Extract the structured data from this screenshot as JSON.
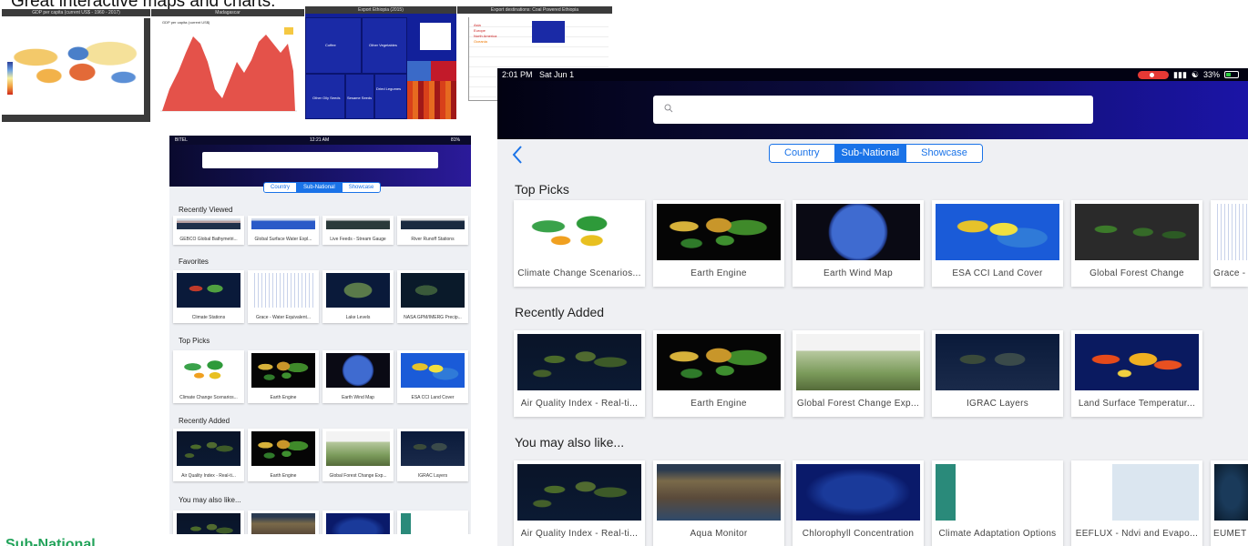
{
  "slide": {
    "title": "Great interactive maps and charts:",
    "footer": "Sub-National",
    "accent_color": "#22a35a"
  },
  "top_thumbnails": [
    {
      "header": "GDP per capita (current US$ - 1960 - 2017)",
      "legend_items": [
        "166,000",
        "50,000",
        "20,000",
        "10,000",
        "5,000",
        "2,000",
        "1,000",
        "500",
        "No data"
      ]
    },
    {
      "header": "Madagascar",
      "y_label": "GDP per capita (current US$)"
    },
    {
      "header": "Export Ethiopia (2015)",
      "cells": [
        "Coffee",
        "Other Vegetables",
        "Other Oily Seeds",
        "Dried Legumes",
        "Sesame Seeds"
      ]
    },
    {
      "header": "Export destinations: Coal Powered Ethiopia",
      "legend": [
        "Asia",
        "Europe",
        "North America",
        "Oceania"
      ]
    }
  ],
  "phone": {
    "status": {
      "carrier": "BITEL",
      "time": "12:21 AM",
      "battery": "81%"
    },
    "segments": [
      "Country",
      "Sub-National",
      "Showcase"
    ],
    "active_segment": "Sub-National",
    "sections": [
      {
        "title": "Recently Viewed",
        "items": [
          "GEBCO Global Bathymetri...",
          "Global Surface Water Expl...",
          "Live Feeds - Stream Gauge",
          "River Runoff Stations"
        ]
      },
      {
        "title": "Favorites",
        "items": [
          "Climate Stations",
          "Grace - Water Equivalent...",
          "Lake Levels",
          "NASA GPM/IMERG Precip..."
        ]
      },
      {
        "title": "Top Picks",
        "items": [
          "Climate Change Scenarios...",
          "Earth Engine",
          "Earth Wind Map",
          "ESA CCI Land Cover"
        ]
      },
      {
        "title": "Recently Added",
        "items": [
          "Air Quality Index - Real-ti...",
          "Earth Engine",
          "Global Forest Change Exp...",
          "IGRAC Layers"
        ]
      },
      {
        "title": "You may also like..."
      }
    ]
  },
  "ipad": {
    "status": {
      "time": "2:01 PM",
      "date": "Sat Jun 1",
      "battery": "33%"
    },
    "segments": [
      "Country",
      "Sub-National",
      "Showcase"
    ],
    "active_segment": "Sub-National",
    "sections": [
      {
        "title": "Top Picks",
        "items": [
          "Climate Change Scenarios...",
          "Earth Engine",
          "Earth Wind Map",
          "ESA CCI Land Cover",
          "Global Forest Change",
          "Grace - "
        ]
      },
      {
        "title": "Recently Added",
        "items": [
          "Air Quality Index - Real-ti...",
          "Earth Engine",
          "Global Forest Change Exp...",
          "IGRAC Layers",
          "Land Surface Temperatur..."
        ]
      },
      {
        "title": "You may also like...",
        "items": [
          "Air Quality Index - Real-ti...",
          "Aqua Monitor",
          "Chlorophyll Concentration",
          "Climate Adaptation Options",
          "EEFLUX - Ndvi and Evapo...",
          "EUMET"
        ]
      }
    ]
  }
}
